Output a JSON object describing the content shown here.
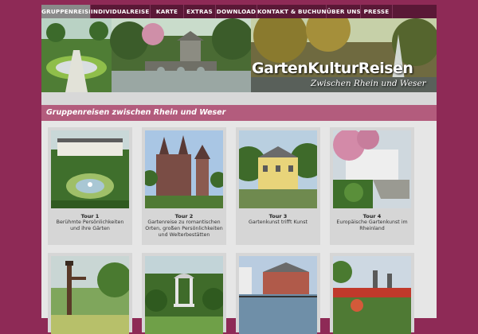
{
  "nav": {
    "items": [
      {
        "label": "GRUPPENREISEN",
        "active": true
      },
      {
        "label": "INDIVIDUALREISEN",
        "active": false
      },
      {
        "label": "KARTE",
        "active": false
      },
      {
        "label": "EXTRAS",
        "active": false
      },
      {
        "label": "DOWNLOAD",
        "active": false
      },
      {
        "label": "KONTAKT & BUCHUNG",
        "active": false
      },
      {
        "label": "ÜBER UNS",
        "active": false
      },
      {
        "label": "PRESSE",
        "active": false
      }
    ]
  },
  "banner": {
    "logo": "GartenKulturReisen",
    "tagline": "Zwischen Rhein und Weser"
  },
  "section": {
    "title": "Gruppenreisen zwischen Rhein und Weser"
  },
  "tours": [
    {
      "title": "Tour 1",
      "desc": "Berühmte Persönlichkeiten und ihre Gärten"
    },
    {
      "title": "Tour 2",
      "desc": "Gartenreise zu romantischen Orten, großen Persönlichkeiten und Welterbestätten"
    },
    {
      "title": "Tour 3",
      "desc": "Gartenkunst trifft Kunst"
    },
    {
      "title": "Tour 4",
      "desc": "Europäische Gartenkunst im Rheinland"
    }
  ],
  "colors": {
    "accent": "#8e2a56",
    "nav_bg": "#5a1836",
    "section_head": "#b35c7d"
  }
}
